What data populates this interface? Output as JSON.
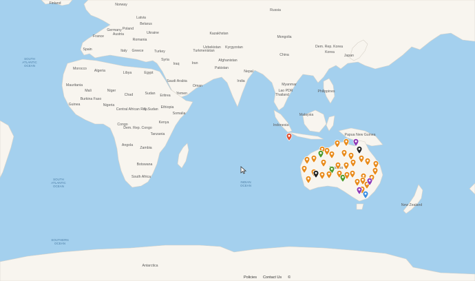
{
  "map": {
    "colors": {
      "ocean": "#a4d0ee",
      "land": "#f8f5ef",
      "border": "#d7d2c8",
      "pin_orange": "#e88a1a",
      "pin_green": "#4f9a2a",
      "pin_purple": "#8e3ab5",
      "pin_black": "#222222",
      "pin_blue": "#3d8fe0",
      "pin_red": "#e05030"
    },
    "ocean_labels": [
      {
        "text": "SOUTH\nATLANTIC\nOCEAN",
        "key": "south-atlantic-north"
      },
      {
        "text": "SOUTH\nATLANTIC\nOCEAN",
        "key": "south-atlantic"
      },
      {
        "text": "INDIAN\nOCEAN",
        "key": "indian"
      },
      {
        "text": "SOUTHERN\nOCEAN",
        "key": "southern"
      }
    ],
    "country_labels": [
      "Finland",
      "Norway",
      "Russia",
      "Latvia",
      "Belarus",
      "Poland",
      "Germany",
      "Ukraine",
      "Austria",
      "France",
      "Romania",
      "Kazakhstan",
      "Mongolia",
      "Uzbekistan",
      "Kyrgyzstan",
      "Turkmenistan",
      "Spain",
      "Italy",
      "Greece",
      "Turkey",
      "Syria",
      "Iraq",
      "Iran",
      "Afghanistan",
      "Pakistan",
      "China",
      "Dem. Rep. Korea",
      "Korea",
      "Japan",
      "Morocco",
      "Algeria",
      "Libya",
      "Egypt",
      "Saudi Arabia",
      "Oman",
      "Yemen",
      "Nepal",
      "India",
      "Myanmar",
      "Lao PDR",
      "Thailand",
      "Philippines",
      "Mauritania",
      "Mali",
      "Niger",
      "Chad",
      "Sudan",
      "Eritrea",
      "Burkina Faso",
      "Nigeria",
      "Guinea",
      "Central African Rep.",
      "Ethiopia",
      "S. Sudan",
      "Somalia",
      "Congo",
      "Dem. Rep. Congo",
      "Kenya",
      "Tanzania",
      "Angola",
      "Zambia",
      "Botswana",
      "South Africa",
      "Malaysia",
      "Indonesia",
      "Papua New Guinea",
      "Australia",
      "New Zealand",
      "Antarctica"
    ],
    "markers": [
      {
        "type": "red"
      },
      {
        "type": "orange"
      },
      {
        "type": "orange"
      },
      {
        "type": "orange"
      },
      {
        "type": "orange"
      },
      {
        "type": "purple"
      },
      {
        "type": "black"
      },
      {
        "type": "orange"
      },
      {
        "type": "green"
      },
      {
        "type": "orange"
      },
      {
        "type": "orange"
      },
      {
        "type": "orange"
      },
      {
        "type": "orange"
      },
      {
        "type": "orange"
      },
      {
        "type": "orange"
      },
      {
        "type": "orange"
      },
      {
        "type": "orange"
      },
      {
        "type": "orange"
      },
      {
        "type": "orange"
      },
      {
        "type": "green"
      },
      {
        "type": "orange"
      },
      {
        "type": "orange"
      },
      {
        "type": "orange"
      },
      {
        "type": "orange"
      },
      {
        "type": "orange"
      },
      {
        "type": "black"
      },
      {
        "type": "orange"
      },
      {
        "type": "green"
      },
      {
        "type": "orange"
      },
      {
        "type": "orange"
      },
      {
        "type": "orange"
      },
      {
        "type": "orange"
      },
      {
        "type": "orange"
      },
      {
        "type": "orange"
      },
      {
        "type": "orange"
      },
      {
        "type": "orange"
      },
      {
        "type": "orange"
      },
      {
        "type": "purple"
      },
      {
        "type": "orange"
      },
      {
        "type": "purple"
      },
      {
        "type": "blue"
      }
    ]
  },
  "footer": {
    "policies": "Policies",
    "contact": "Contact Us",
    "copyright": "©"
  }
}
